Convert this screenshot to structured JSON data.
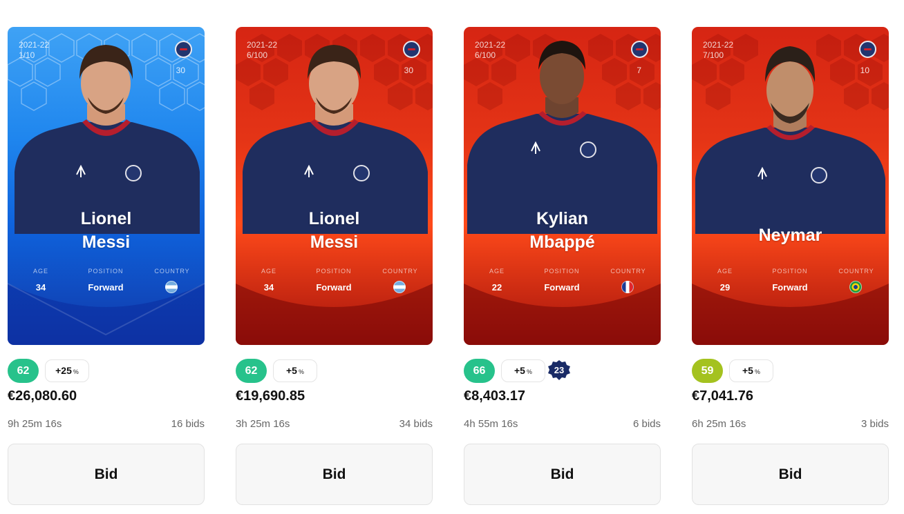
{
  "cards": [
    {
      "season": "2021-22",
      "serial": "1/10",
      "jersey": "30",
      "first": "Lionel",
      "last": "Messi",
      "age_label": "AGE",
      "position_label": "POSITION",
      "country_label": "COUNTRY",
      "age": "34",
      "position": "Forward",
      "country_flag": "argentina-flag",
      "rarity": "blue",
      "score": "62",
      "score_color": "#27c28b",
      "bonus": "+25",
      "bonus_unit": "%",
      "price": "€26,080.60",
      "time": "9h 25m 16s",
      "bids": "16 bids",
      "bid_label": "Bid"
    },
    {
      "season": "2021-22",
      "serial": "6/100",
      "jersey": "30",
      "first": "Lionel",
      "last": "Messi",
      "age_label": "AGE",
      "position_label": "POSITION",
      "country_label": "COUNTRY",
      "age": "34",
      "position": "Forward",
      "country_flag": "argentina-flag",
      "rarity": "red",
      "score": "62",
      "score_color": "#27c28b",
      "bonus": "+5",
      "bonus_unit": "%",
      "price": "€19,690.85",
      "time": "3h 25m 16s",
      "bids": "34 bids",
      "bid_label": "Bid"
    },
    {
      "season": "2021-22",
      "serial": "6/100",
      "jersey": "7",
      "first": "Kylian",
      "last": "Mbappé",
      "age_label": "AGE",
      "position_label": "POSITION",
      "country_label": "COUNTRY",
      "age": "22",
      "position": "Forward",
      "country_flag": "france-flag",
      "rarity": "red",
      "score": "66",
      "score_color": "#27c28b",
      "bonus": "+5",
      "bonus_unit": "%",
      "serial_badge": "23",
      "price": "€8,403.17",
      "time": "4h 55m 16s",
      "bids": "6 bids",
      "bid_label": "Bid"
    },
    {
      "season": "2021-22",
      "serial": "7/100",
      "jersey": "10",
      "first": "",
      "last": "Neymar",
      "age_label": "AGE",
      "position_label": "POSITION",
      "country_label": "COUNTRY",
      "age": "29",
      "position": "Forward",
      "country_flag": "brazil-flag",
      "rarity": "red",
      "score": "59",
      "score_color": "#a4c21f",
      "bonus": "+5",
      "bonus_unit": "%",
      "price": "€7,041.76",
      "time": "6h 25m 16s",
      "bids": "3 bids",
      "bid_label": "Bid"
    }
  ]
}
